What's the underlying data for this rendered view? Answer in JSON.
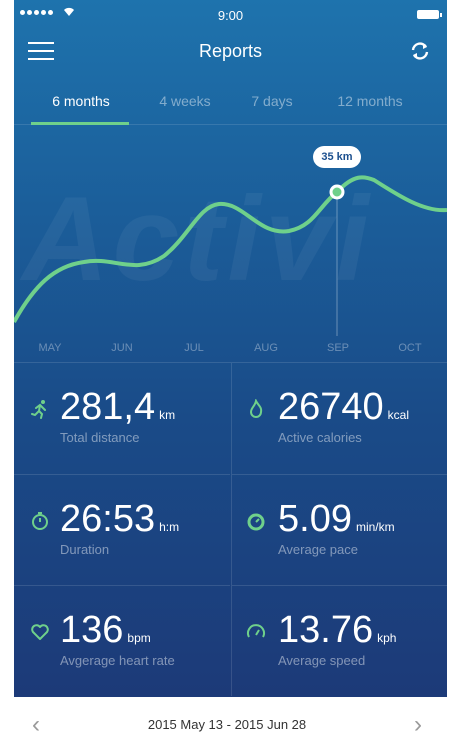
{
  "status_bar": {
    "time": "9:00"
  },
  "header": {
    "title": "Reports"
  },
  "tabs": [
    {
      "label": "6 months",
      "active": true
    },
    {
      "label": "4 weeks",
      "active": false
    },
    {
      "label": "7 days",
      "active": false
    },
    {
      "label": "12 months",
      "active": false
    }
  ],
  "background_text": "Activi",
  "chart_data": {
    "type": "line",
    "categories": [
      "MAY",
      "JUN",
      "JUL",
      "AUG",
      "SEP",
      "OCT"
    ],
    "highlight": {
      "category": "SEP",
      "label": "35 km"
    },
    "line_color": "#6fd08b"
  },
  "stats": [
    {
      "icon": "running-icon",
      "value": "281,4",
      "unit": "km",
      "label": "Total distance"
    },
    {
      "icon": "flame-icon",
      "value": "26740",
      "unit": "kcal",
      "label": "Active calories"
    },
    {
      "icon": "stopwatch-icon",
      "value": "26:53",
      "unit": "h:m",
      "label": "Duration"
    },
    {
      "icon": "pace-timer-icon",
      "value": "5.09",
      "unit": "min/km",
      "label": "Average pace"
    },
    {
      "icon": "heart-icon",
      "value": "136",
      "unit": "bpm",
      "label": "Avgerage heart rate"
    },
    {
      "icon": "speedometer-icon",
      "value": "13.76",
      "unit": "kph",
      "label": "Average speed"
    }
  ],
  "footer": {
    "range": "2015 May 13 - 2015 Jun 28",
    "prev": "‹",
    "next": "›"
  },
  "colors": {
    "accent": "#6fd08b",
    "background_top": "#1e73ad",
    "background_bottom": "#1c3a78"
  }
}
